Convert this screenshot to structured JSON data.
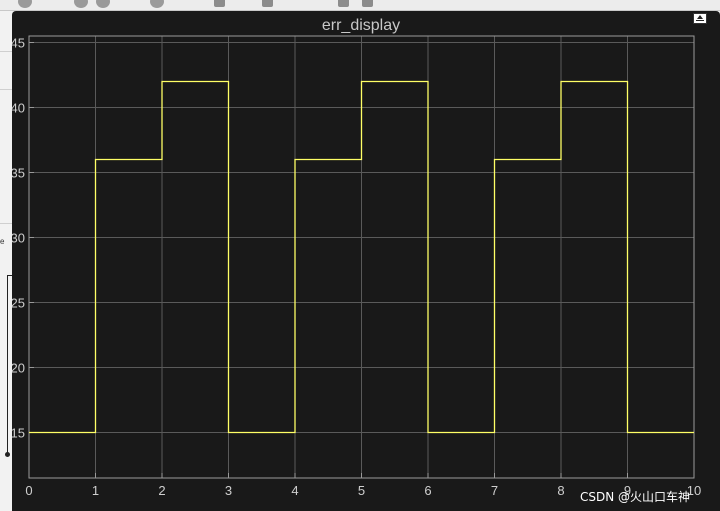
{
  "window": {
    "title": "err_display"
  },
  "watermark": "CSDN @火山口车神",
  "left_panel": {
    "glyph": "e"
  },
  "chart_data": {
    "type": "line",
    "title": "err_display",
    "xlabel": "",
    "ylabel": "",
    "xlim": [
      0,
      10
    ],
    "ylim": [
      11.5,
      45.5
    ],
    "x_ticks": [
      "0",
      "1",
      "2",
      "3",
      "4",
      "5",
      "6",
      "7",
      "8",
      "9",
      "10"
    ],
    "y_ticks": [
      "15",
      "20",
      "25",
      "30",
      "35",
      "40",
      "45"
    ],
    "grid": true,
    "step": true,
    "series": [
      {
        "color": "#ffff66",
        "x": [
          0,
          1,
          1,
          2,
          2,
          3,
          3,
          4,
          4,
          5,
          5,
          6,
          6,
          7,
          7,
          8,
          8,
          9,
          9,
          10
        ],
        "y": [
          15,
          15,
          36,
          36,
          42,
          42,
          15,
          15,
          36,
          36,
          42,
          42,
          15,
          15,
          36,
          36,
          42,
          42,
          15,
          15
        ]
      }
    ]
  }
}
